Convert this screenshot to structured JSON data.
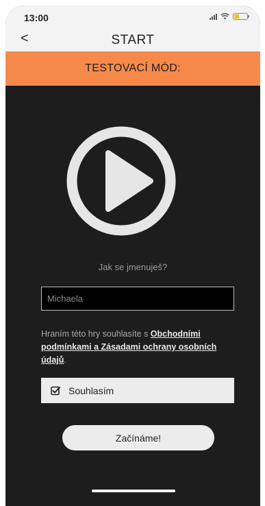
{
  "status_bar": {
    "time": "13:00"
  },
  "header": {
    "back_icon": "chevron-left-icon",
    "back_glyph": "<",
    "title": "START"
  },
  "banner": {
    "text": "TESTOVACÍ MÓD:",
    "color": "#f58a4b"
  },
  "player": {
    "icon": "play-icon"
  },
  "form": {
    "question": "Jak se jmenuješ?",
    "name_value": "Michaela",
    "consent_prefix": "Hraním této hry souhlasíte s ",
    "consent_link": "Obchodními podmínkami a Zásadami ochrany osobních údajů",
    "consent_suffix": ".",
    "agree_label": "Souhlasím",
    "agree_checked": true,
    "submit_label": "Začínáme!"
  },
  "theme": {
    "background": "#1d1d1d",
    "accent": "#f58a4b"
  }
}
